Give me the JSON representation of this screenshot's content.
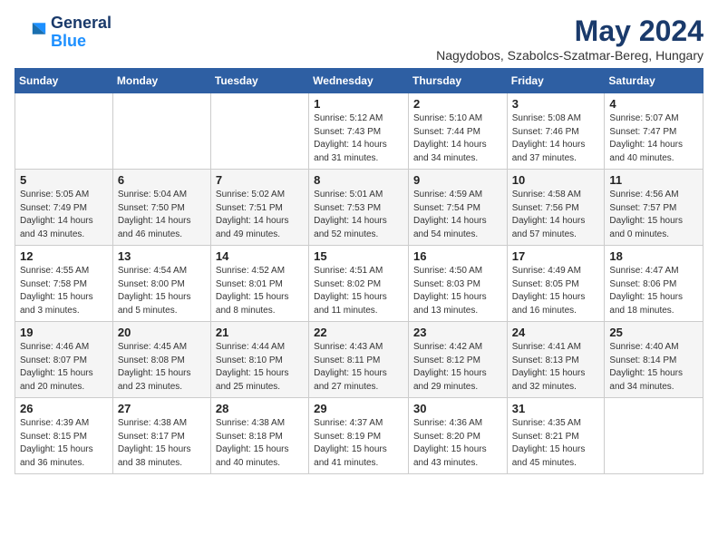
{
  "logo": {
    "line1": "General",
    "line2": "Blue"
  },
  "title": "May 2024",
  "subtitle": "Nagydobos, Szabolcs-Szatmar-Bereg, Hungary",
  "days_of_week": [
    "Sunday",
    "Monday",
    "Tuesday",
    "Wednesday",
    "Thursday",
    "Friday",
    "Saturday"
  ],
  "weeks": [
    [
      {
        "day": "",
        "info": ""
      },
      {
        "day": "",
        "info": ""
      },
      {
        "day": "",
        "info": ""
      },
      {
        "day": "1",
        "info": "Sunrise: 5:12 AM\nSunset: 7:43 PM\nDaylight: 14 hours\nand 31 minutes."
      },
      {
        "day": "2",
        "info": "Sunrise: 5:10 AM\nSunset: 7:44 PM\nDaylight: 14 hours\nand 34 minutes."
      },
      {
        "day": "3",
        "info": "Sunrise: 5:08 AM\nSunset: 7:46 PM\nDaylight: 14 hours\nand 37 minutes."
      },
      {
        "day": "4",
        "info": "Sunrise: 5:07 AM\nSunset: 7:47 PM\nDaylight: 14 hours\nand 40 minutes."
      }
    ],
    [
      {
        "day": "5",
        "info": "Sunrise: 5:05 AM\nSunset: 7:49 PM\nDaylight: 14 hours\nand 43 minutes."
      },
      {
        "day": "6",
        "info": "Sunrise: 5:04 AM\nSunset: 7:50 PM\nDaylight: 14 hours\nand 46 minutes."
      },
      {
        "day": "7",
        "info": "Sunrise: 5:02 AM\nSunset: 7:51 PM\nDaylight: 14 hours\nand 49 minutes."
      },
      {
        "day": "8",
        "info": "Sunrise: 5:01 AM\nSunset: 7:53 PM\nDaylight: 14 hours\nand 52 minutes."
      },
      {
        "day": "9",
        "info": "Sunrise: 4:59 AM\nSunset: 7:54 PM\nDaylight: 14 hours\nand 54 minutes."
      },
      {
        "day": "10",
        "info": "Sunrise: 4:58 AM\nSunset: 7:56 PM\nDaylight: 14 hours\nand 57 minutes."
      },
      {
        "day": "11",
        "info": "Sunrise: 4:56 AM\nSunset: 7:57 PM\nDaylight: 15 hours\nand 0 minutes."
      }
    ],
    [
      {
        "day": "12",
        "info": "Sunrise: 4:55 AM\nSunset: 7:58 PM\nDaylight: 15 hours\nand 3 minutes."
      },
      {
        "day": "13",
        "info": "Sunrise: 4:54 AM\nSunset: 8:00 PM\nDaylight: 15 hours\nand 5 minutes."
      },
      {
        "day": "14",
        "info": "Sunrise: 4:52 AM\nSunset: 8:01 PM\nDaylight: 15 hours\nand 8 minutes."
      },
      {
        "day": "15",
        "info": "Sunrise: 4:51 AM\nSunset: 8:02 PM\nDaylight: 15 hours\nand 11 minutes."
      },
      {
        "day": "16",
        "info": "Sunrise: 4:50 AM\nSunset: 8:03 PM\nDaylight: 15 hours\nand 13 minutes."
      },
      {
        "day": "17",
        "info": "Sunrise: 4:49 AM\nSunset: 8:05 PM\nDaylight: 15 hours\nand 16 minutes."
      },
      {
        "day": "18",
        "info": "Sunrise: 4:47 AM\nSunset: 8:06 PM\nDaylight: 15 hours\nand 18 minutes."
      }
    ],
    [
      {
        "day": "19",
        "info": "Sunrise: 4:46 AM\nSunset: 8:07 PM\nDaylight: 15 hours\nand 20 minutes."
      },
      {
        "day": "20",
        "info": "Sunrise: 4:45 AM\nSunset: 8:08 PM\nDaylight: 15 hours\nand 23 minutes."
      },
      {
        "day": "21",
        "info": "Sunrise: 4:44 AM\nSunset: 8:10 PM\nDaylight: 15 hours\nand 25 minutes."
      },
      {
        "day": "22",
        "info": "Sunrise: 4:43 AM\nSunset: 8:11 PM\nDaylight: 15 hours\nand 27 minutes."
      },
      {
        "day": "23",
        "info": "Sunrise: 4:42 AM\nSunset: 8:12 PM\nDaylight: 15 hours\nand 29 minutes."
      },
      {
        "day": "24",
        "info": "Sunrise: 4:41 AM\nSunset: 8:13 PM\nDaylight: 15 hours\nand 32 minutes."
      },
      {
        "day": "25",
        "info": "Sunrise: 4:40 AM\nSunset: 8:14 PM\nDaylight: 15 hours\nand 34 minutes."
      }
    ],
    [
      {
        "day": "26",
        "info": "Sunrise: 4:39 AM\nSunset: 8:15 PM\nDaylight: 15 hours\nand 36 minutes."
      },
      {
        "day": "27",
        "info": "Sunrise: 4:38 AM\nSunset: 8:17 PM\nDaylight: 15 hours\nand 38 minutes."
      },
      {
        "day": "28",
        "info": "Sunrise: 4:38 AM\nSunset: 8:18 PM\nDaylight: 15 hours\nand 40 minutes."
      },
      {
        "day": "29",
        "info": "Sunrise: 4:37 AM\nSunset: 8:19 PM\nDaylight: 15 hours\nand 41 minutes."
      },
      {
        "day": "30",
        "info": "Sunrise: 4:36 AM\nSunset: 8:20 PM\nDaylight: 15 hours\nand 43 minutes."
      },
      {
        "day": "31",
        "info": "Sunrise: 4:35 AM\nSunset: 8:21 PM\nDaylight: 15 hours\nand 45 minutes."
      },
      {
        "day": "",
        "info": ""
      }
    ]
  ]
}
